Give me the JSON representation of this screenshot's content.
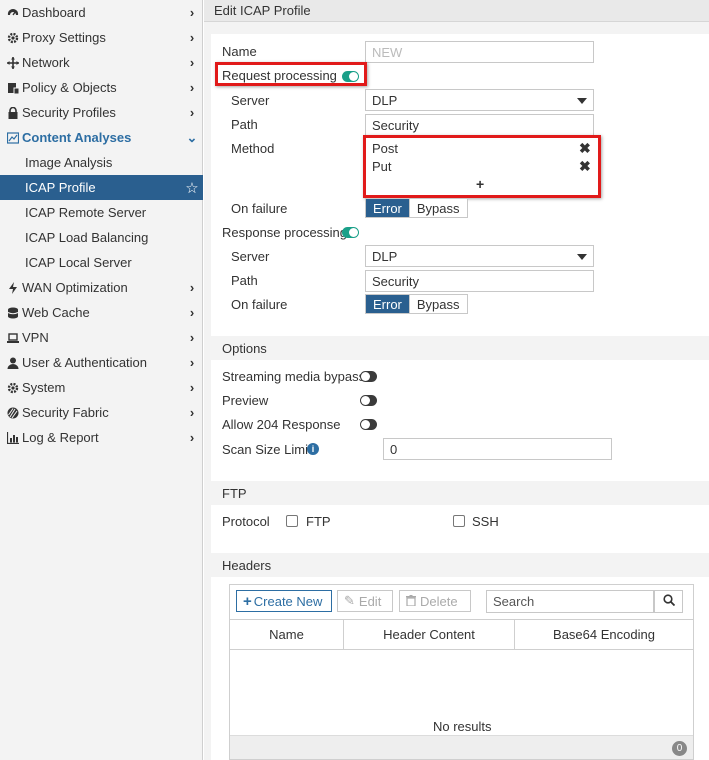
{
  "sidebar": {
    "items": [
      {
        "label": "Dashboard",
        "icon": "dashboard-icon"
      },
      {
        "label": "Proxy Settings",
        "icon": "gear-icon"
      },
      {
        "label": "Network",
        "icon": "network-icon"
      },
      {
        "label": "Policy & Objects",
        "icon": "policy-icon"
      },
      {
        "label": "Security Profiles",
        "icon": "lock-icon"
      },
      {
        "label": "Content Analyses",
        "icon": "content-analyses-icon"
      },
      {
        "label": "Image Analysis"
      },
      {
        "label": "ICAP Profile"
      },
      {
        "label": "ICAP Remote Server"
      },
      {
        "label": "ICAP Load Balancing"
      },
      {
        "label": "ICAP Local Server"
      },
      {
        "label": "WAN Optimization",
        "icon": "bolt-icon"
      },
      {
        "label": "Web Cache",
        "icon": "database-icon"
      },
      {
        "label": "VPN",
        "icon": "laptop-icon"
      },
      {
        "label": "User & Authentication",
        "icon": "user-icon"
      },
      {
        "label": "System",
        "icon": "gear-icon"
      },
      {
        "label": "Security Fabric",
        "icon": "fabric-icon"
      },
      {
        "label": "Log & Report",
        "icon": "chart-icon"
      }
    ]
  },
  "page": {
    "title": "Edit ICAP Profile"
  },
  "form": {
    "name_label": "Name",
    "name_placeholder": "NEW",
    "request_processing_label": "Request processing",
    "server_label": "Server",
    "server_value": "DLP",
    "path_label": "Path",
    "path_value": "Security",
    "method_label": "Method",
    "methods": [
      "Post",
      "Put"
    ],
    "add_method": "+",
    "on_failure_label": "On failure",
    "error_label": "Error",
    "bypass_label": "Bypass",
    "response_processing_label": "Response processing",
    "resp_server_value": "DLP",
    "resp_path_value": "Security"
  },
  "options": {
    "header": "Options",
    "streaming_label": "Streaming media bypass",
    "preview_label": "Preview",
    "allow204_label": "Allow 204 Response",
    "scan_size_label": "Scan Size Limit",
    "scan_size_value": "0"
  },
  "ftp": {
    "header": "FTP",
    "protocol_label": "Protocol",
    "ftp_label": "FTP",
    "ssh_label": "SSH"
  },
  "headers": {
    "header": "Headers",
    "create_new": "Create New",
    "edit": "Edit",
    "delete": "Delete",
    "search_placeholder": "Search",
    "columns": [
      "Name",
      "Header Content",
      "Base64 Encoding"
    ],
    "empty_text": "No results",
    "count": "0"
  },
  "colors": {
    "accent": "#2a5f8f",
    "toggle_on": "#1aa089",
    "highlight": "#e11a1a"
  }
}
